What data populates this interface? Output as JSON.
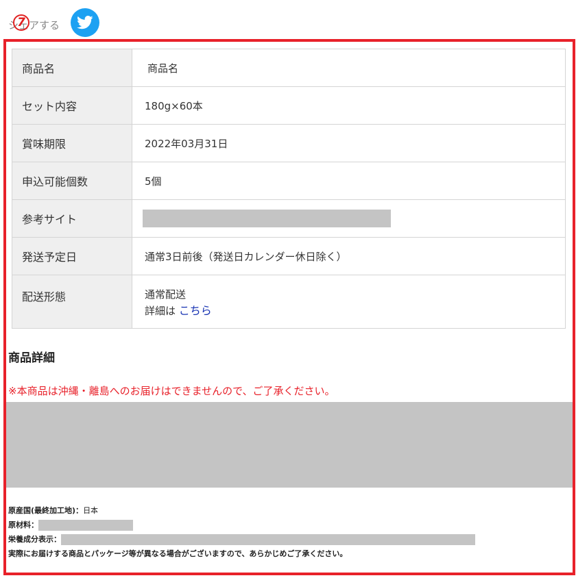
{
  "share": {
    "label": "シェアする",
    "step_number": "7",
    "twitter_icon": "twitter-bird-icon"
  },
  "specs": [
    {
      "key": "商品名",
      "value": "商品名"
    },
    {
      "key": "セット内容",
      "value": "180g×60本"
    },
    {
      "key": "賞味期限",
      "value": "2022年03月31日"
    },
    {
      "key": "申込可能個数",
      "value": "5個"
    },
    {
      "key": "参考サイト",
      "value": ""
    },
    {
      "key": "発送予定日",
      "value": "通常3日前後（発送日カレンダー休日除く）"
    },
    {
      "key": "配送形態",
      "value": "通常配送",
      "detail_prefix": "詳細は",
      "detail_link": "こちら"
    }
  ],
  "detail": {
    "heading": "商品詳細",
    "notice": "※本商品は沖縄・離島へのお届けはできませんので、ご了承ください。"
  },
  "info": {
    "origin_label": "原産国(最終加工地)：",
    "origin_value": "日本",
    "ingredients_label": "原材料：",
    "nutrition_label": "栄養成分表示：",
    "disclaimer": "実際にお届けする商品とパッケージ等が異なる場合がございますので、あらかじめご了承ください。"
  },
  "colors": {
    "frame_red": "#e8212a",
    "twitter_blue": "#1da1f2",
    "link_blue": "#1a35b3"
  }
}
